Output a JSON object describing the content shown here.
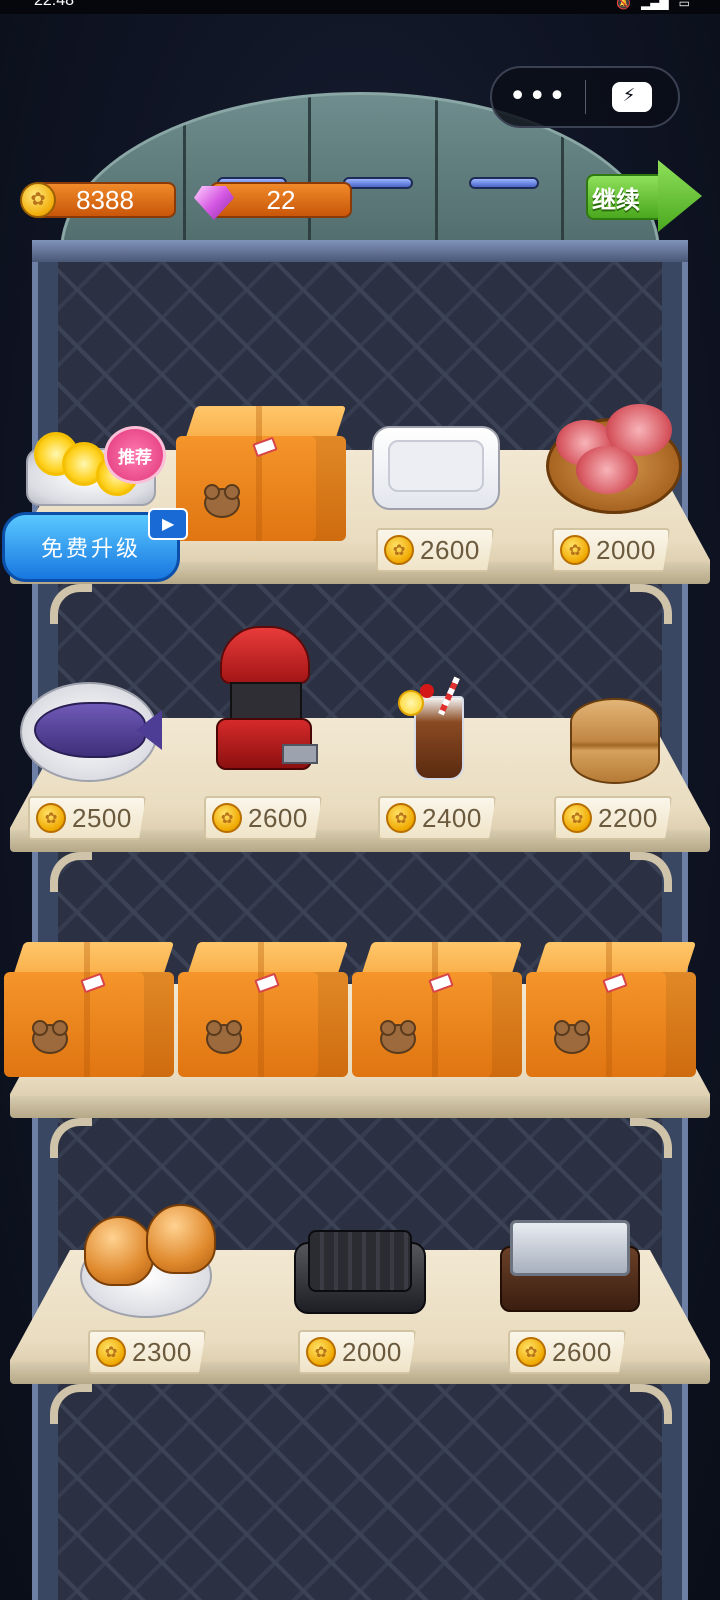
{
  "status_bar": {
    "time": "22:48",
    "icons": [
      "bell-off-icon",
      "hd-icon",
      "signal-icon",
      "signal-icon",
      "battery-icon"
    ]
  },
  "capsule": {
    "more_icon": "more-dots-icon",
    "game_icon": "gamepad-icon"
  },
  "currency": {
    "gold": "8388",
    "gems": "22"
  },
  "continue_label": "继续",
  "upgrade": {
    "label": "免费升级",
    "badge": "推荐"
  },
  "shelves": [
    {
      "items": [
        {
          "name": "lemon-plate",
          "price": null
        },
        {
          "name": "mystery-box",
          "price": null
        },
        {
          "name": "paw-plate",
          "price": "2600"
        },
        {
          "name": "meat-board",
          "price": "2000"
        }
      ]
    },
    {
      "items": [
        {
          "name": "grilled-fish",
          "price": "2500"
        },
        {
          "name": "cola-machine",
          "price": "2600"
        },
        {
          "name": "cola-drink",
          "price": "2400"
        },
        {
          "name": "wood-cake",
          "price": "2200"
        }
      ]
    },
    {
      "items": [
        {
          "name": "mystery-box",
          "price": null
        },
        {
          "name": "mystery-box",
          "price": null
        },
        {
          "name": "mystery-box",
          "price": null
        },
        {
          "name": "mystery-box",
          "price": null
        }
      ]
    },
    {
      "items": [
        {
          "name": "burger-buns",
          "price": "2300"
        },
        {
          "name": "grill-pan",
          "price": "2000"
        },
        {
          "name": "steam-tray",
          "price": "2600"
        }
      ]
    }
  ],
  "colors": {
    "accent_orange": "#e0751a",
    "continue_green": "#4aa81e",
    "upgrade_blue": "#1877e0"
  }
}
